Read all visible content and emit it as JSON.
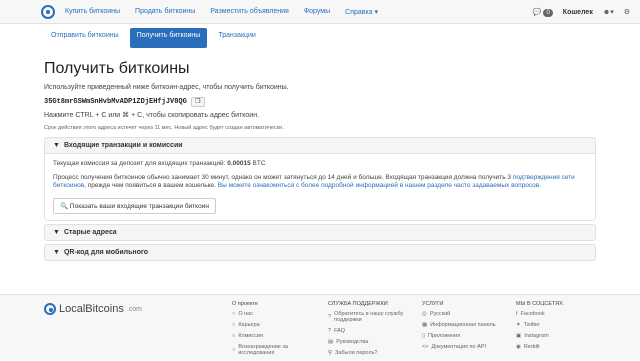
{
  "nav": {
    "items": [
      "Купить биткоины",
      "Продать биткоины",
      "Разместить объявления",
      "Форумы",
      "Справка ▾"
    ],
    "messages_count": "0",
    "wallet": "Кошелек",
    "user_icon": "user-icon",
    "settings_icon": "gear-icon"
  },
  "tabs": {
    "send": "Отправить биткоины",
    "receive": "Получить биткоины",
    "transactions": "Транзакции"
  },
  "main": {
    "title": "Получить биткоины",
    "intro": "Используйте приведенный ниже биткоин-адрес, чтобы получить биткоины.",
    "address": "35Gt8mrGSWmSnHvbMvADP1ZDjEHfjJV8QG",
    "copy_hint": "Нажмите CTRL + C или ⌘ + C, чтобы скопировать адрес биткоин.",
    "expiry_note": "Срок действия этого адреса истечет через 11 мес. Новый адрес будет создан автоматически."
  },
  "panel_fees": {
    "title": "Входящие транзакции и комиссии",
    "fee_text": "Текущая комиссия за депозит для входящих транзакций:",
    "fee_value": "0.00015",
    "fee_unit": "BTC",
    "process_text_1": "Процесс получения биткоинов обычно занимает 30 минут, однако он может затянуться до 14 дней и больше. Входящая транзакция должна получить 3",
    "process_link_1": "подтверждения сети биткоинов",
    "process_text_2": ", прежде чем появиться в вашем кошельке.",
    "process_link_2": "Вы можете ознакомиться с более подробной информацией в нашем разделе часто задаваемых вопросов.",
    "show_button": "Показать ваши входящие транзакции биткоин"
  },
  "panel_old": {
    "title": "Старые адреса"
  },
  "panel_qr": {
    "title": "QR-код для мобильного"
  },
  "footer": {
    "brand": "LocalBitcoins",
    "brand_suffix": ".com",
    "col1": {
      "title": "О проекте",
      "items": [
        "О нас",
        "Карьера",
        "Комиссия",
        "Вознаграждение за исследования"
      ]
    },
    "col2": {
      "title": "СЛУЖБА ПОДДЕРЖКИ",
      "items": [
        "Обратитесь в нашу службу поддержки",
        "FAQ",
        "Руководства",
        "Забыли пароль?"
      ]
    },
    "col3": {
      "title": "УСЛУГИ",
      "items": [
        "Русский",
        "Информационная панель",
        "Приложения",
        "Документация по API"
      ]
    },
    "col4": {
      "title": "МЫ В СОЦСЕТЯХ",
      "items": [
        "Facebook",
        "Twitter",
        "Instagram",
        "Reddit"
      ]
    }
  }
}
